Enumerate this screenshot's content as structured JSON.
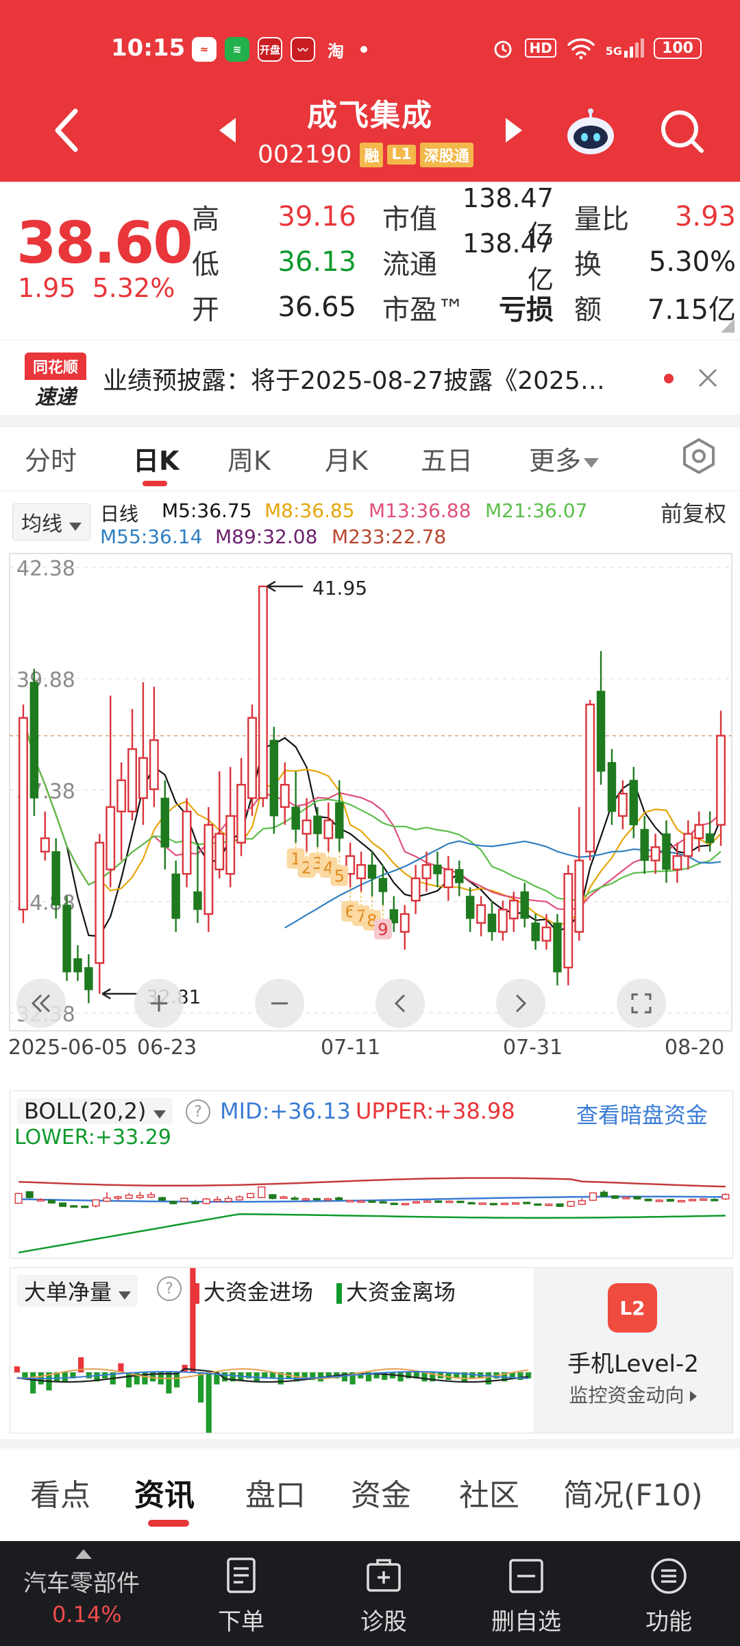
{
  "status_bar": {
    "time": "10:15",
    "apps": [
      "开盘",
      "淘"
    ],
    "network": "HD",
    "signal": "5G",
    "battery": "100"
  },
  "header": {
    "stock_name": "成飞集成",
    "stock_code": "002190",
    "tags": [
      "融",
      "L1",
      "深股通"
    ]
  },
  "quote": {
    "price": "38.60",
    "change": "1.95",
    "change_pct": "5.32%",
    "high_label": "高",
    "high": "39.16",
    "low_label": "低",
    "low": "36.13",
    "open_label": "开",
    "open": "36.65",
    "mktcap_label": "市值",
    "mktcap": "138.47亿",
    "float_label": "流通",
    "float": "138.47亿",
    "pe_label": "市盈™",
    "pe": "亏损",
    "vr_label": "量比",
    "vr": "3.93",
    "turnover_label": "换",
    "turnover": "5.30%",
    "amount_label": "额",
    "amount": "7.15亿"
  },
  "news": {
    "logo_top": "同花顺",
    "logo_bottom": "速递",
    "text": "业绩预披露：将于2025-08-27披露《2025…"
  },
  "period_tabs": [
    "分时",
    "日K",
    "周K",
    "月K",
    "五日",
    "更多"
  ],
  "ma_legend": {
    "select": "均线",
    "kind": "日线",
    "fuquan": "前复权",
    "items": [
      {
        "label": "M5:36.75",
        "color": "#111111"
      },
      {
        "label": "M8:36.85",
        "color": "#e5a50a"
      },
      {
        "label": "M13:36.88",
        "color": "#e0507a"
      },
      {
        "label": "M21:36.07",
        "color": "#5bbf4a"
      },
      {
        "label": "M55:36.14",
        "color": "#2f7fc1"
      },
      {
        "label": "M89:32.08",
        "color": "#6b1f6e"
      },
      {
        "label": "M233:22.78",
        "color": "#b8452e"
      }
    ]
  },
  "chart_data": {
    "type": "candlestick",
    "ylim": [
      32.38,
      42.38
    ],
    "y_ticks": [
      "42.38",
      "39.88",
      "37.38",
      "34.88",
      "32.38"
    ],
    "x_labels": [
      "2025-06-05",
      "06-23",
      "07-11",
      "07-31",
      "08-20"
    ],
    "max_marker": "41.95",
    "min_marker": "32.81",
    "sequence_markers": [
      "1",
      "2",
      "3",
      "4",
      "5",
      "6",
      "7",
      "8",
      "9"
    ],
    "candles": [
      {
        "o": 34.7,
        "c": 39.0,
        "h": 39.3,
        "l": 34.4
      },
      {
        "o": 39.8,
        "c": 37.2,
        "h": 40.1,
        "l": 36.8
      },
      {
        "o": 36.0,
        "c": 36.3,
        "h": 36.9,
        "l": 35.8
      },
      {
        "o": 36.0,
        "c": 34.8,
        "h": 36.3,
        "l": 34.5
      },
      {
        "o": 34.8,
        "c": 33.3,
        "h": 35.0,
        "l": 33.1
      },
      {
        "o": 33.6,
        "c": 33.3,
        "h": 33.9,
        "l": 33.1
      },
      {
        "o": 33.4,
        "c": 32.9,
        "h": 33.7,
        "l": 32.6
      },
      {
        "o": 33.5,
        "c": 36.2,
        "h": 36.4,
        "l": 32.81
      },
      {
        "o": 35.6,
        "c": 37.0,
        "h": 39.5,
        "l": 35.2
      },
      {
        "o": 36.9,
        "c": 37.6,
        "h": 38.0,
        "l": 35.8
      },
      {
        "o": 36.9,
        "c": 38.3,
        "h": 39.2,
        "l": 36.7
      },
      {
        "o": 37.2,
        "c": 38.1,
        "h": 39.8,
        "l": 36.6
      },
      {
        "o": 37.4,
        "c": 38.5,
        "h": 39.7,
        "l": 37.0
      },
      {
        "o": 37.2,
        "c": 36.1,
        "h": 37.6,
        "l": 35.6
      },
      {
        "o": 35.5,
        "c": 34.5,
        "h": 35.8,
        "l": 34.2
      },
      {
        "o": 35.5,
        "c": 36.9,
        "h": 37.2,
        "l": 35.2
      },
      {
        "o": 35.1,
        "c": 34.7,
        "h": 36.2,
        "l": 34.4
      },
      {
        "o": 34.6,
        "c": 36.6,
        "h": 37.0,
        "l": 34.2
      },
      {
        "o": 35.6,
        "c": 36.4,
        "h": 37.8,
        "l": 35.4
      },
      {
        "o": 35.5,
        "c": 36.8,
        "h": 37.9,
        "l": 35.2
      },
      {
        "o": 36.2,
        "c": 37.5,
        "h": 38.1,
        "l": 35.9
      },
      {
        "o": 37.2,
        "c": 39.0,
        "h": 39.3,
        "l": 36.8
      },
      {
        "o": 37.2,
        "c": 41.95,
        "h": 41.95,
        "l": 37.0
      },
      {
        "o": 38.5,
        "c": 36.8,
        "h": 38.8,
        "l": 36.4
      },
      {
        "o": 37.0,
        "c": 37.5,
        "h": 38.0,
        "l": 36.6
      },
      {
        "o": 37.0,
        "c": 36.5,
        "h": 37.8,
        "l": 36.2
      },
      {
        "o": 36.4,
        "c": 36.7,
        "h": 37.2,
        "l": 36.0
      },
      {
        "o": 36.8,
        "c": 36.4,
        "h": 37.0,
        "l": 36.1
      },
      {
        "o": 36.3,
        "c": 36.7,
        "h": 37.1,
        "l": 36.0
      },
      {
        "o": 37.1,
        "c": 36.3,
        "h": 37.6,
        "l": 36.0
      },
      {
        "o": 35.5,
        "c": 35.9,
        "h": 36.2,
        "l": 35.2
      },
      {
        "o": 35.4,
        "c": 35.7,
        "h": 36.0,
        "l": 35.1
      },
      {
        "o": 35.7,
        "c": 35.4,
        "h": 36.0,
        "l": 35.0
      },
      {
        "o": 35.4,
        "c": 35.1,
        "h": 35.7,
        "l": 34.8
      },
      {
        "o": 34.7,
        "c": 34.4,
        "h": 35.0,
        "l": 34.2
      },
      {
        "o": 34.2,
        "c": 34.6,
        "h": 34.8,
        "l": 33.8
      },
      {
        "o": 34.9,
        "c": 35.4,
        "h": 35.7,
        "l": 34.6
      },
      {
        "o": 35.4,
        "c": 35.7,
        "h": 36.0,
        "l": 35.1
      },
      {
        "o": 35.7,
        "c": 35.5,
        "h": 36.0,
        "l": 35.2
      },
      {
        "o": 35.2,
        "c": 35.6,
        "h": 35.9,
        "l": 34.9
      },
      {
        "o": 35.6,
        "c": 35.3,
        "h": 35.8,
        "l": 35.0
      },
      {
        "o": 35.0,
        "c": 34.5,
        "h": 35.2,
        "l": 34.2
      },
      {
        "o": 34.4,
        "c": 34.8,
        "h": 35.0,
        "l": 34.1
      },
      {
        "o": 34.6,
        "c": 34.2,
        "h": 34.9,
        "l": 34.0
      },
      {
        "o": 34.2,
        "c": 34.7,
        "h": 34.9,
        "l": 34.0
      },
      {
        "o": 34.5,
        "c": 34.9,
        "h": 35.1,
        "l": 34.2
      },
      {
        "o": 35.1,
        "c": 34.5,
        "h": 35.3,
        "l": 34.3
      },
      {
        "o": 34.4,
        "c": 34.0,
        "h": 34.6,
        "l": 33.8
      },
      {
        "o": 34.0,
        "c": 34.3,
        "h": 34.6,
        "l": 33.8
      },
      {
        "o": 34.4,
        "c": 33.3,
        "h": 34.6,
        "l": 33.0
      },
      {
        "o": 33.4,
        "c": 35.5,
        "h": 35.7,
        "l": 33.0
      },
      {
        "o": 34.2,
        "c": 35.8,
        "h": 37.0,
        "l": 34.0
      },
      {
        "o": 36.0,
        "c": 39.3,
        "h": 39.4,
        "l": 35.8
      },
      {
        "o": 39.6,
        "c": 37.8,
        "h": 40.5,
        "l": 37.5
      },
      {
        "o": 38.0,
        "c": 36.9,
        "h": 38.3,
        "l": 36.6
      },
      {
        "o": 36.8,
        "c": 37.3,
        "h": 37.6,
        "l": 36.5
      },
      {
        "o": 37.6,
        "c": 36.6,
        "h": 37.9,
        "l": 36.3
      },
      {
        "o": 36.5,
        "c": 35.8,
        "h": 36.8,
        "l": 35.5
      },
      {
        "o": 35.8,
        "c": 36.1,
        "h": 36.4,
        "l": 35.5
      },
      {
        "o": 36.4,
        "c": 35.6,
        "h": 36.7,
        "l": 35.3
      },
      {
        "o": 35.6,
        "c": 35.9,
        "h": 36.2,
        "l": 35.3
      },
      {
        "o": 35.9,
        "c": 36.4,
        "h": 36.7,
        "l": 35.6
      },
      {
        "o": 36.3,
        "c": 36.6,
        "h": 36.9,
        "l": 36.0
      },
      {
        "o": 36.4,
        "c": 36.2,
        "h": 36.9,
        "l": 36.0
      },
      {
        "o": 36.6,
        "c": 38.6,
        "h": 39.16,
        "l": 36.13
      }
    ]
  },
  "boll": {
    "select": "BOLL(20,2)",
    "mid": "MID:+36.13",
    "upper": "UPPER:+38.98",
    "lower": "LOWER:+33.29",
    "link": "查看暗盘资金"
  },
  "money": {
    "select": "大单净量",
    "inflow": "大资金进场",
    "outflow": "大资金离场",
    "l2_logo": "L2",
    "l2_title": "手机Level-2",
    "l2_sub": "监控资金动向"
  },
  "info_tabs": [
    "看点",
    "资讯",
    "盘口",
    "资金",
    "社区",
    "简况(F10)"
  ],
  "bottom_bar": {
    "sector": "汽车零部件",
    "sector_pct": "0.14%",
    "buttons": [
      "下单",
      "诊股",
      "删自选",
      "功能"
    ]
  }
}
